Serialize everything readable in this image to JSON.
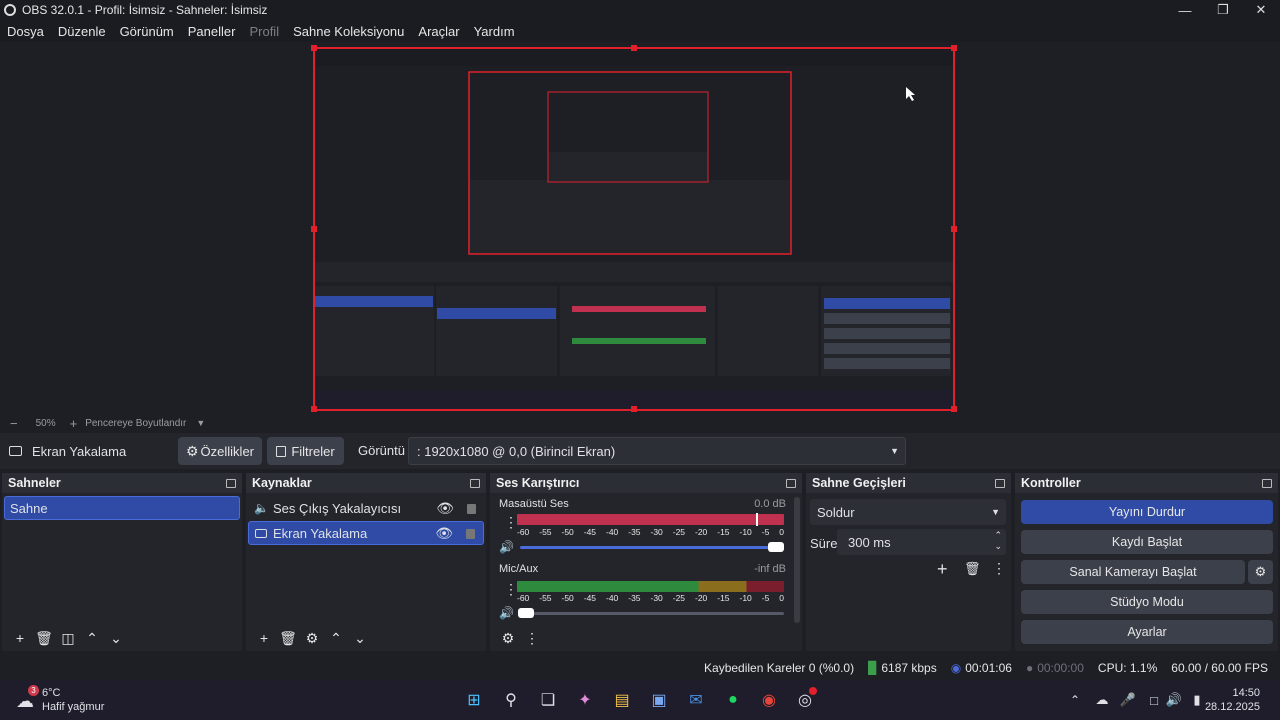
{
  "window": {
    "title": "OBS 32.0.1 - Profil: İsimsiz - Sahneler: İsimsiz"
  },
  "menu": [
    "Dosya",
    "Düzenle",
    "Görünüm",
    "Paneller",
    "Profil",
    "Sahne Koleksiyonu",
    "Araçlar",
    "Yardım"
  ],
  "menu_disabled": [
    "Profil"
  ],
  "preview": {
    "zoom": "50%",
    "scale_mode": "Pencereye Boyutlandır"
  },
  "source_bar": {
    "source_name": "Ekran Yakalama",
    "properties_label": "Özellikler",
    "filters_label": "Filtreler",
    "display_label": "Görüntü",
    "display_value": ": 1920x1080 @ 0,0 (Birincil Ekran)"
  },
  "scenes": {
    "title": "Sahneler",
    "items": [
      "Sahne"
    ],
    "selected": 0
  },
  "sources": {
    "title": "Kaynaklar",
    "items": [
      {
        "label": "Ses Çıkış Yakalayıcısı",
        "icon": "speaker-icon"
      },
      {
        "label": "Ekran Yakalama",
        "icon": "monitor-icon"
      }
    ],
    "selected": 1
  },
  "mixer": {
    "title": "Ses Karıştırıcı",
    "channels": [
      {
        "name": "Masaüstü Ses",
        "level": "0.0 dB",
        "volume": 1.0
      },
      {
        "name": "Mic/Aux",
        "level": "-inf dB",
        "volume": 0.0
      }
    ],
    "ticks": [
      "-60",
      "-55",
      "-50",
      "-45",
      "-40",
      "-35",
      "-30",
      "-25",
      "-20",
      "-15",
      "-10",
      "-5",
      "0"
    ]
  },
  "transitions": {
    "title": "Sahne Geçişleri",
    "type": "Soldur",
    "duration_label": "Süre",
    "duration_value": "300 ms"
  },
  "controls": {
    "title": "Kontroller",
    "stream": "Yayını Durdur",
    "record": "Kaydı Başlat",
    "virtualcam": "Sanal Kamerayı Başlat",
    "studio": "Stüdyo Modu",
    "settings": "Ayarlar"
  },
  "status": {
    "dropped": "Kaybedilen Kareler 0 (%0.0)",
    "bitrate": "6187 kbps",
    "stream_time": "00:01:06",
    "rec_time": "00:00:00",
    "cpu": "CPU: 1.1%",
    "fps": "60.00 / 60.00 FPS"
  },
  "taskbar": {
    "weather_temp": "6°C",
    "weather_desc": "Hafif yağmur",
    "weather_badge": "3",
    "time": "14:50",
    "date": "28.12.2025"
  },
  "colors": {
    "accent": "#2f4ba5",
    "meter_red": "#c0304f",
    "meter_green": "#2e8b3e",
    "meter_yellow": "#b38a22",
    "record_red": "#e0202a"
  }
}
